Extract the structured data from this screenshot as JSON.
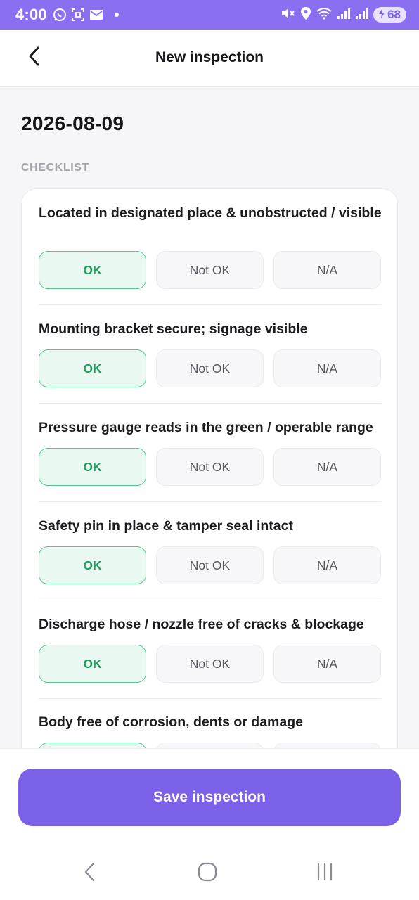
{
  "status_bar": {
    "time": "4:00",
    "battery": "68",
    "icons": [
      "whatsapp-icon",
      "screenshot-icon",
      "mail-icon",
      "mute-icon",
      "location-icon",
      "wifi-icon",
      "signal-icon",
      "signal-icon",
      "charging-icon"
    ]
  },
  "header": {
    "title": "New inspection",
    "back_icon": "chevron-left-icon"
  },
  "date": "2026-08-09",
  "section_label": "CHECKLIST",
  "options": {
    "ok": "OK",
    "not_ok": "Not OK",
    "na": "N/A"
  },
  "checklist": [
    {
      "question": "Located in designated place & unobstructed / visible",
      "selected": "OK"
    },
    {
      "question": "Mounting bracket secure; signage visible",
      "selected": "OK"
    },
    {
      "question": "Pressure gauge reads in the green / operable range",
      "selected": "OK"
    },
    {
      "question": "Safety pin in place & tamper seal intact",
      "selected": "OK"
    },
    {
      "question": "Discharge hose / nozzle free of cracks & blockage",
      "selected": "OK"
    },
    {
      "question": "Body free of corrosion, dents or damage",
      "selected": "OK"
    }
  ],
  "save_button": "Save inspection",
  "nav": {
    "back_icon": "nav-back-icon",
    "home_icon": "nav-home-icon",
    "recents_icon": "nav-recents-icon"
  },
  "colors": {
    "accent": "#7b61e8",
    "status_bar": "#8a6ff0",
    "ok_fill": "#e9f9f1",
    "ok_border": "#4fcb8d",
    "ok_text": "#1f9c5e"
  }
}
